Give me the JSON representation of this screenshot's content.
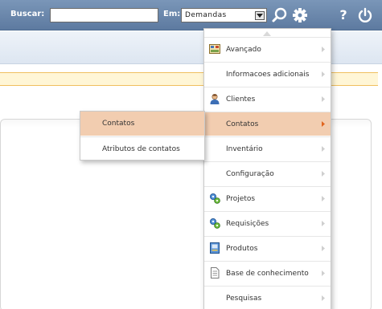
{
  "search": {
    "label": "Buscar:",
    "value": "",
    "placeholder": "",
    "scope_label": "Em:",
    "scope_value": "Demandas"
  },
  "toolbar_icons": [
    "search-icon",
    "gear-icon",
    "help-icon",
    "power-icon"
  ],
  "help_glyph": "?",
  "menu": {
    "items": [
      {
        "label": "Avançado",
        "icon": "advanced-icon"
      },
      {
        "label": "Informacoes adicionais",
        "icon": ""
      },
      {
        "label": "Clientes",
        "icon": "client-icon"
      },
      {
        "label": "Contatos",
        "icon": "",
        "active": true
      },
      {
        "label": "Inventário",
        "icon": ""
      },
      {
        "label": "Configuração",
        "icon": ""
      },
      {
        "label": "Projetos",
        "icon": "gears-icon"
      },
      {
        "label": "Requisições",
        "icon": "gears-icon"
      },
      {
        "label": "Produtos",
        "icon": "product-icon"
      },
      {
        "label": "Base de conhecimento",
        "icon": "document-icon"
      },
      {
        "label": "Pesquisas",
        "icon": ""
      }
    ]
  },
  "submenu": {
    "items": [
      {
        "label": "Contatos",
        "active": true
      },
      {
        "label": "Atributos de contatos"
      }
    ]
  },
  "colors": {
    "topbar": "#6b89ad",
    "highlight": "#f2cdb0",
    "notice_border": "#f0c060"
  }
}
